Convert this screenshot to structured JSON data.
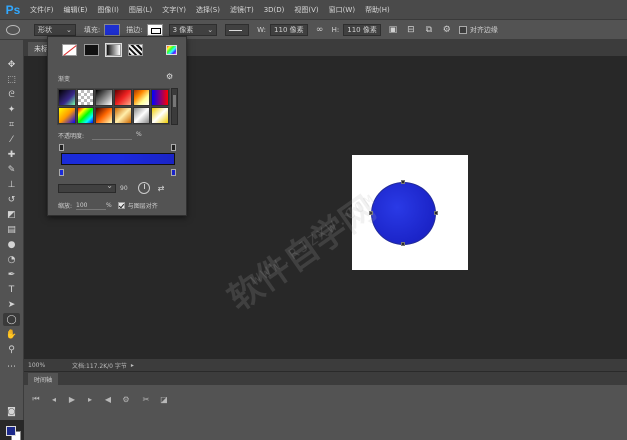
{
  "menubar": {
    "logo": "Ps",
    "items": [
      "文件(F)",
      "编辑(E)",
      "图像(I)",
      "图层(L)",
      "文字(Y)",
      "选择(S)",
      "滤镜(T)",
      "3D(D)",
      "视图(V)",
      "窗口(W)",
      "帮助(H)"
    ]
  },
  "options": {
    "mode": "形状",
    "fill_label": "填充:",
    "stroke_label": "描边:",
    "stroke_width": "3 像素",
    "w_label": "W:",
    "w_value": "110 像素",
    "h_label": "H:",
    "h_value": "110 像素",
    "align_edges": "对齐边缘",
    "fill_color": "#1d2fd0"
  },
  "document": {
    "tab_title": "未标"
  },
  "popup": {
    "gradient_label": "渐变",
    "opacity_label": "不透明度:",
    "opacity_unit": "%",
    "angle_value": "90",
    "scale_label": "缩放:",
    "scale_value": "100",
    "scale_unit": "%",
    "align_layer": "与图层对齐",
    "presets": [
      "linear-gradient(135deg,#000 0%,#3a2a8a 60%,#7fa 100%)",
      "repeating-conic-gradient(#bbb 0 25%,#fff 0 50%) 0 0/6px 6px",
      "linear-gradient(135deg,#000,#fff)",
      "linear-gradient(135deg,#600,#e22,#fa8)",
      "linear-gradient(135deg,#a30,#f80,#ff9,#fff)",
      "linear-gradient(90deg,#00f,#f00)",
      "linear-gradient(135deg,#ff0,#f90,#00f)",
      "linear-gradient(135deg,#f00,#ff0,#0f0,#0ff,#00f)",
      "linear-gradient(135deg,#400,#f60,#ffb)",
      "linear-gradient(135deg,#c60,#fea,#c60)",
      "linear-gradient(135deg,#888,#fff,#888)",
      "linear-gradient(135deg,#ec0,#fff,#ec0)"
    ]
  },
  "status": {
    "zoom": "100%",
    "doc_info": "文档:117.2K/0 字节",
    "arrow": "▸"
  },
  "timeline": {
    "tab_label": "时间轴"
  },
  "watermark": {
    "text": "软件自学网",
    "url": "WWW.RJZXW.COM"
  }
}
